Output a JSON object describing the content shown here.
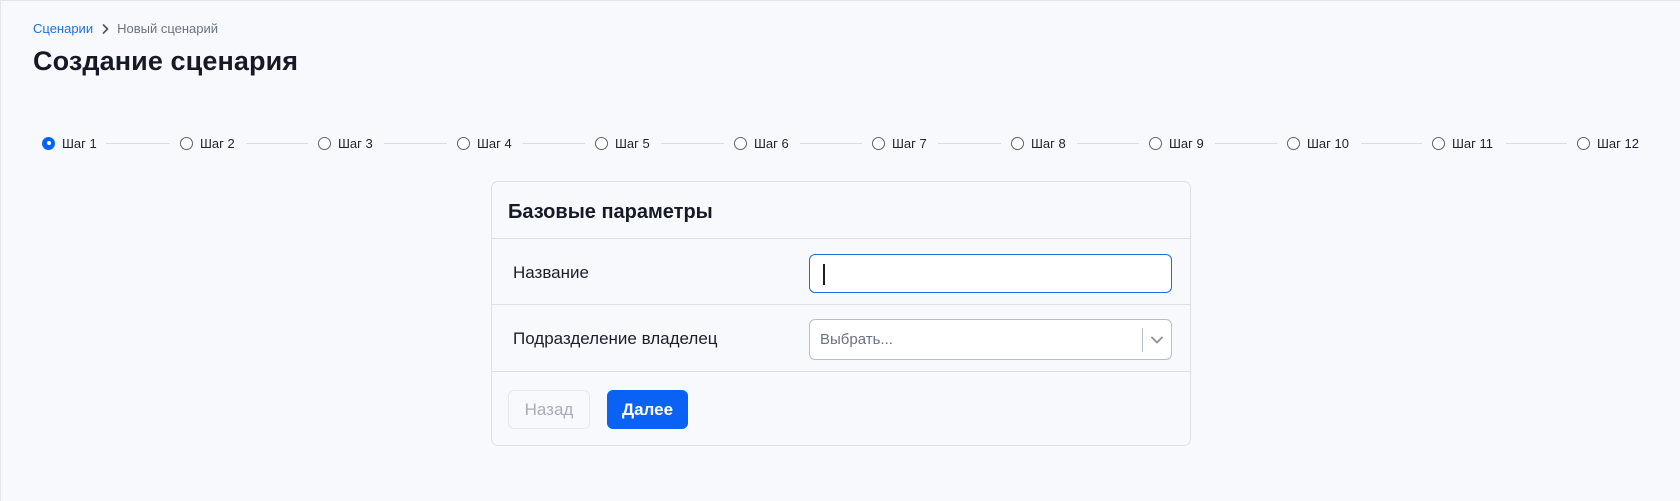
{
  "breadcrumb": {
    "parent": "Сценарии",
    "current": "Новый сценарий"
  },
  "page": {
    "title": "Создание сценария"
  },
  "stepper": {
    "active_index": 0,
    "steps": [
      "Шаг 1",
      "Шаг 2",
      "Шаг 3",
      "Шаг 4",
      "Шаг 5",
      "Шаг 6",
      "Шаг 7",
      "Шаг 8",
      "Шаг 9",
      "Шаг 10",
      "Шаг 11",
      "Шаг 12"
    ]
  },
  "form": {
    "title": "Базовые параметры",
    "name_label": "Название",
    "name_value": "",
    "owner_label": "Подразделение владелец",
    "owner_placeholder": "Выбрать...",
    "back_label": "Назад",
    "next_label": "Далее"
  },
  "colors": {
    "accent": "#0a62f5",
    "link": "#1f6fd8",
    "background": "#f8f9fc",
    "border": "#dcdfe5",
    "disabled_text": "#a8adb8"
  },
  "icons": {
    "breadcrumb_separator": "chevron-right-icon",
    "select_arrow": "chevron-down-icon"
  }
}
